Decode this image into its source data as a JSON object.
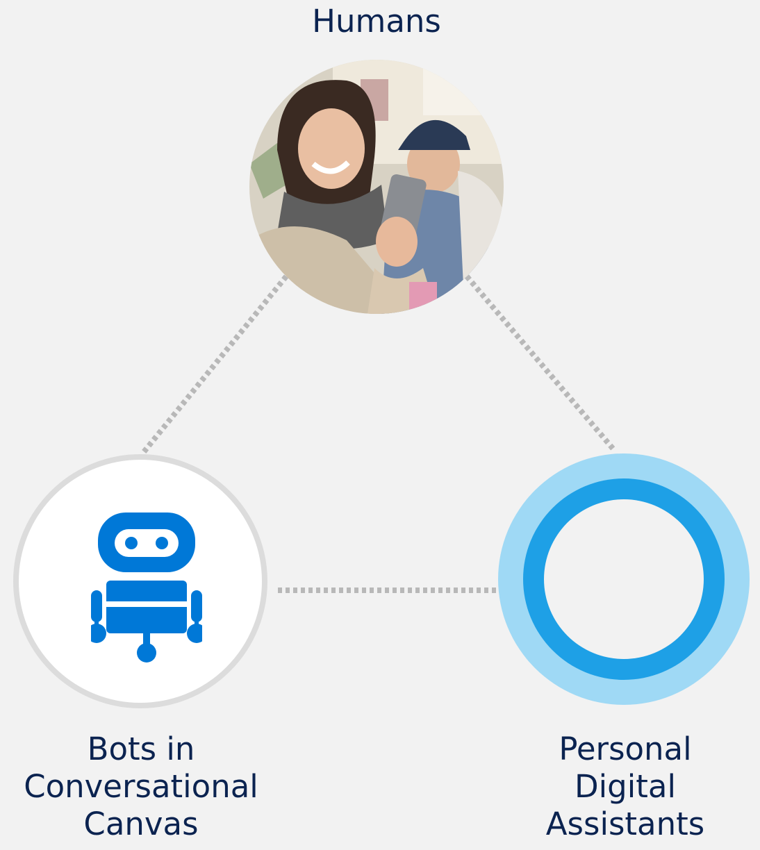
{
  "nodes": {
    "humans": {
      "label": "Humans",
      "icon": "people-with-phone-photo"
    },
    "bots": {
      "label": "Bots in\nConversational\nCanvas",
      "icon": "robot-icon"
    },
    "pda": {
      "label": "Personal\nDigital\nAssistants",
      "icon": "assistant-ring-icon"
    }
  },
  "colors": {
    "text": "#0b2350",
    "background": "#f2f2f2",
    "connector": "#b8b8b8",
    "robot": "#0078d7",
    "ring_inner": "#1ea0e6",
    "ring_outer": "#9fd9f5",
    "bot_circle_border": "#dcdcdc"
  }
}
